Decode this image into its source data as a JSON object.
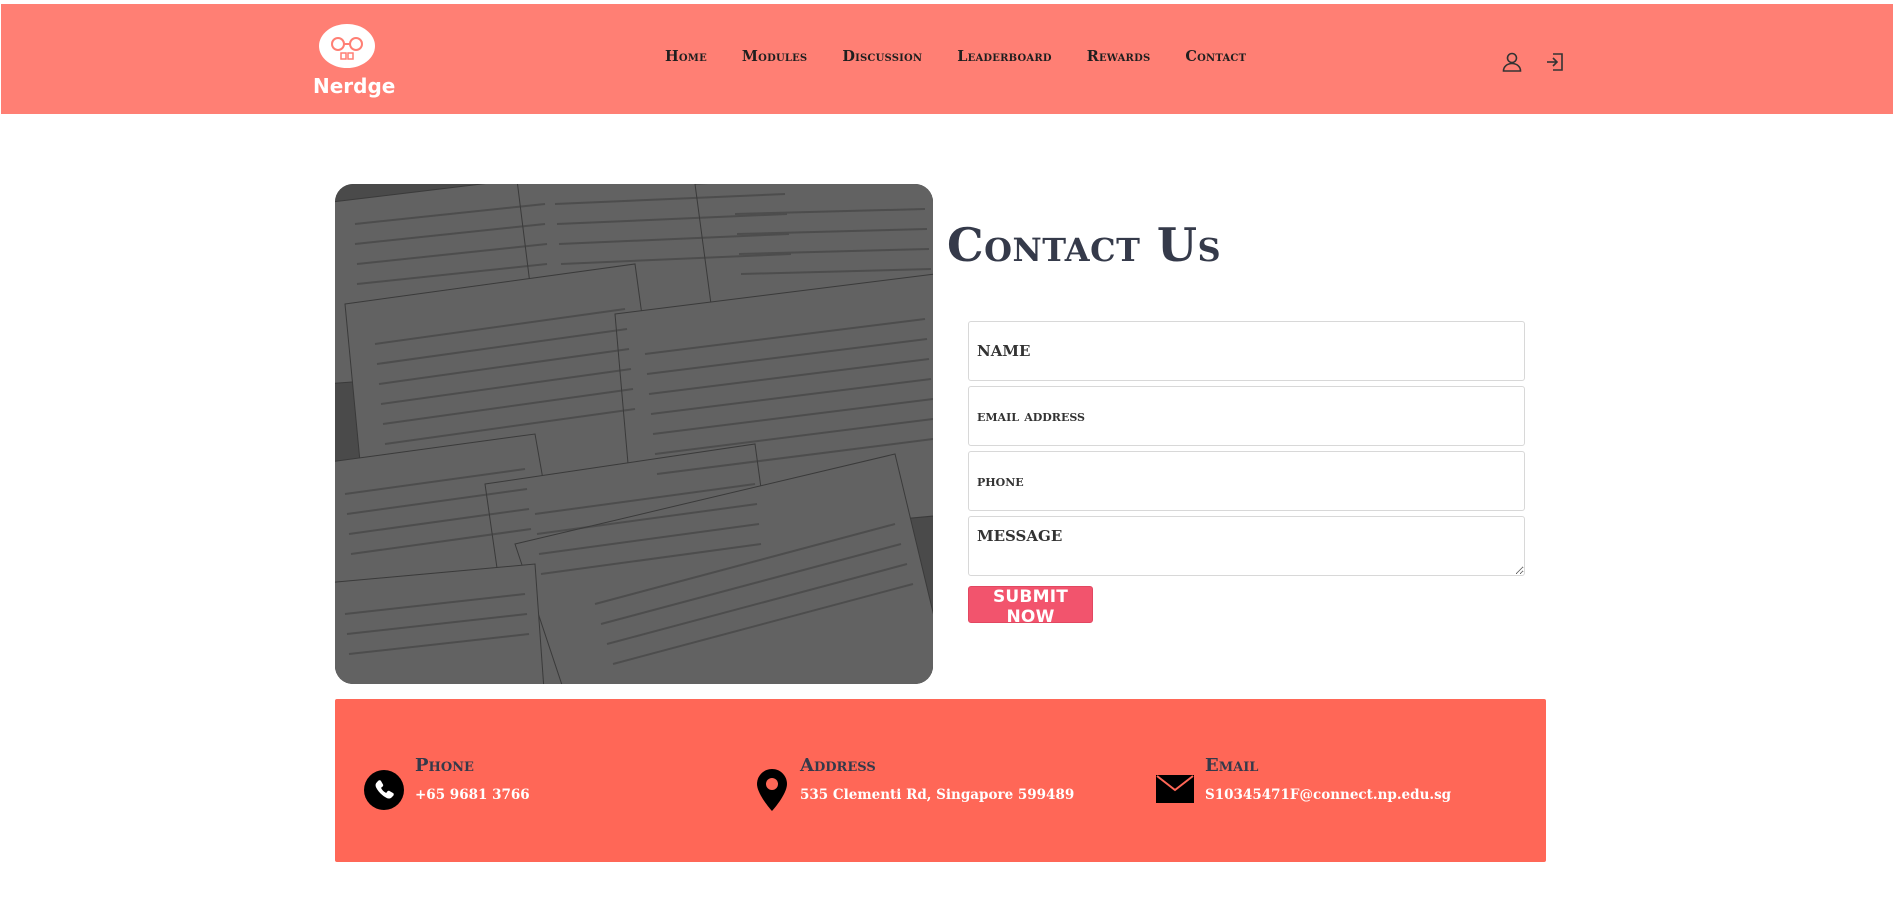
{
  "brand": {
    "name": "Nerdge",
    "logo_icon": "nerd-glasses-icon"
  },
  "nav": {
    "items": [
      "Home",
      "Modules",
      "Discussion",
      "Leaderboard",
      "Rewards",
      "Contact"
    ],
    "profile_icon": "user-icon",
    "login_icon": "sign-in-icon"
  },
  "contact": {
    "title": "Contact Us",
    "fields": {
      "name_placeholder": "NAME",
      "email_placeholder": "email address",
      "phone_placeholder": "phone",
      "message_placeholder": "MESSAGE"
    },
    "submit_label": "SUBMIT NOW"
  },
  "info": {
    "phone": {
      "title": "Phone",
      "value": "+65 9681 3766",
      "icon": "phone-icon"
    },
    "address": {
      "title": "Address",
      "value": "535 Clementi Rd, Singapore 599489",
      "icon": "map-pin-icon"
    },
    "email": {
      "title": "Email",
      "value": "S10345471F@connect.np.edu.sg",
      "icon": "envelope-icon"
    }
  },
  "colors": {
    "navbar": "#ff7f74",
    "info_box": "#ff6757",
    "submit": "#f2546d",
    "heading": "#353a4a"
  }
}
